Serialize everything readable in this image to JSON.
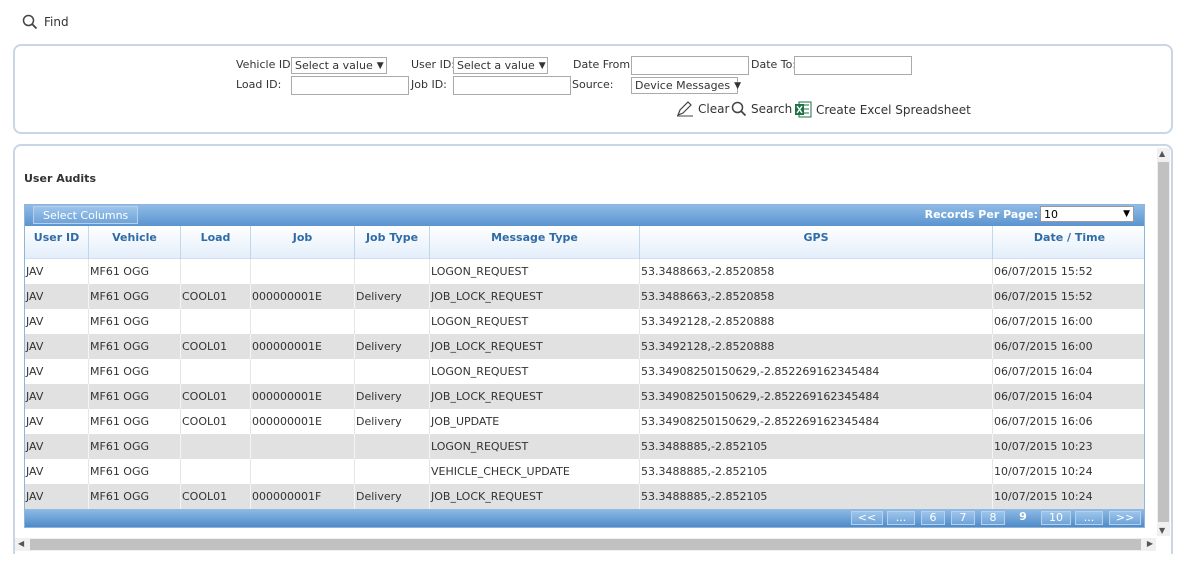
{
  "find": {
    "label": "Find",
    "icon": "search-icon"
  },
  "filters": {
    "vehicle_id_label": "Vehicle ID:",
    "vehicle_id_value": "Select a value",
    "user_id_label": "User ID:",
    "user_id_value": "Select a value",
    "date_from_label": "Date From:",
    "date_from_value": "",
    "date_to_label": "Date To:",
    "date_to_value": "",
    "load_id_label": "Load ID:",
    "load_id_value": "",
    "job_id_label": "Job ID:",
    "job_id_value": "",
    "source_label": "Source:",
    "source_value": "Device Messages"
  },
  "actions": {
    "clear_label": "Clear",
    "search_label": "Search",
    "excel_label": "Create Excel Spreadsheet"
  },
  "section_title": "User Audits",
  "grid": {
    "select_columns_label": "Select Columns",
    "records_per_page_label": "Records Per Page:",
    "records_per_page_value": "10",
    "columns": [
      "User ID",
      "Vehicle",
      "Load",
      "Job",
      "Job Type",
      "Message Type",
      "GPS",
      "Date / Time"
    ],
    "rows": [
      [
        "JAV",
        "MF61 OGG",
        "",
        "",
        "",
        "LOGON_REQUEST",
        "53.3488663,-2.8520858",
        "06/07/2015 15:52"
      ],
      [
        "JAV",
        "MF61 OGG",
        "COOL01",
        "000000001E",
        "Delivery",
        "JOB_LOCK_REQUEST",
        "53.3488663,-2.8520858",
        "06/07/2015 15:52"
      ],
      [
        "JAV",
        "MF61 OGG",
        "",
        "",
        "",
        "LOGON_REQUEST",
        "53.3492128,-2.8520888",
        "06/07/2015 16:00"
      ],
      [
        "JAV",
        "MF61 OGG",
        "COOL01",
        "000000001E",
        "Delivery",
        "JOB_LOCK_REQUEST",
        "53.3492128,-2.8520888",
        "06/07/2015 16:00"
      ],
      [
        "JAV",
        "MF61 OGG",
        "",
        "",
        "",
        "LOGON_REQUEST",
        "53.34908250150629,-2.852269162345484",
        "06/07/2015 16:04"
      ],
      [
        "JAV",
        "MF61 OGG",
        "COOL01",
        "000000001E",
        "Delivery",
        "JOB_LOCK_REQUEST",
        "53.34908250150629,-2.852269162345484",
        "06/07/2015 16:04"
      ],
      [
        "JAV",
        "MF61 OGG",
        "COOL01",
        "000000001E",
        "Delivery",
        "JOB_UPDATE",
        "53.34908250150629,-2.852269162345484",
        "06/07/2015 16:06"
      ],
      [
        "JAV",
        "MF61 OGG",
        "",
        "",
        "",
        "LOGON_REQUEST",
        "53.3488885,-2.852105",
        "10/07/2015 10:23"
      ],
      [
        "JAV",
        "MF61 OGG",
        "",
        "",
        "",
        "VEHICLE_CHECK_UPDATE",
        "53.3488885,-2.852105",
        "10/07/2015 10:24"
      ],
      [
        "JAV",
        "MF61 OGG",
        "COOL01",
        "000000001F",
        "Delivery",
        "JOB_LOCK_REQUEST",
        "53.3488885,-2.852105",
        "10/07/2015 10:24"
      ]
    ]
  },
  "pager": {
    "first": "<<",
    "prev_ellipsis": "...",
    "pages": [
      "6",
      "7",
      "8",
      "9",
      "10"
    ],
    "current": "9",
    "next_ellipsis": "...",
    "last": ">>"
  },
  "colors": {
    "accent": "#5a94cf",
    "header_text": "#2f6ba6",
    "row_alt": "#e1e1e1",
    "excel_green": "#1e7145"
  }
}
